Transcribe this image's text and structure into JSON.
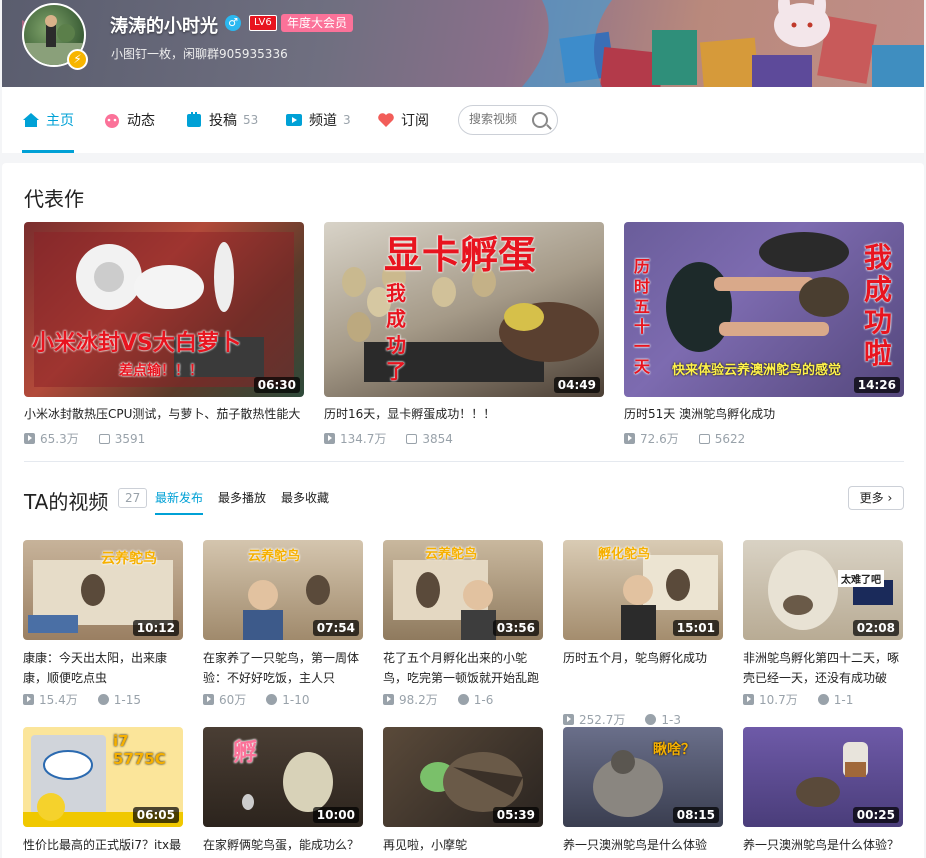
{
  "header": {
    "username": "涛涛的小时光",
    "gender_icon": "♂",
    "level": "LV6",
    "vip": "年度大会员",
    "sign": "小图钉一枚，闲聊群905935336",
    "avatar_badge": "⚡"
  },
  "nav": {
    "tabs": [
      {
        "label": "主页",
        "count": "",
        "icon": "home-icon"
      },
      {
        "label": "动态",
        "count": "",
        "icon": "dynamic-icon"
      },
      {
        "label": "投稿",
        "count": "53",
        "icon": "upload-icon"
      },
      {
        "label": "频道",
        "count": "3",
        "icon": "channel-icon"
      },
      {
        "label": "订阅",
        "count": "",
        "icon": "heart-icon"
      }
    ],
    "search_placeholder": "搜索视频"
  },
  "masterpiece": {
    "title": "代表作",
    "videos": [
      {
        "title": "小米冰封散热压CPU测试，与萝卜、茄子散热性能大",
        "duration": "06:30",
        "views": "65.3万",
        "danmaku": "3591",
        "overlay": "小米冰封VS大白萝卜",
        "overlay2": "差点输！！！"
      },
      {
        "title": "历时16天，显卡孵蛋成功！！！",
        "duration": "04:49",
        "views": "134.7万",
        "danmaku": "3854",
        "overlay": "显卡孵蛋",
        "overlay2": "我成功了"
      },
      {
        "title": "历时51天 澳洲鸵鸟孵化成功",
        "duration": "14:26",
        "views": "72.6万",
        "danmaku": "5622",
        "overlay": "我成功啦",
        "overlay2": "快来体验云养澳洲鸵鸟的感觉",
        "overlay3": "历时五十一天"
      }
    ]
  },
  "videos_section": {
    "title": "TA的视频",
    "count": "27",
    "sort_tabs": [
      "最新发布",
      "最多播放",
      "最多收藏"
    ],
    "more": "更多"
  },
  "videos": [
    {
      "title": "康康：今天出太阳，出来康康，顺便吃点虫",
      "duration": "10:12",
      "views": "15.4万",
      "comments": "1-15",
      "overlay": "云养鸵鸟"
    },
    {
      "title": "在家养了一只鸵鸟，第一周体验：不好好吃饭，主人只",
      "duration": "07:54",
      "views": "60万",
      "comments": "1-10",
      "overlay": "云养鸵鸟"
    },
    {
      "title": "花了五个月孵化出来的小鸵鸟，吃完第一顿饭就开始乱跑",
      "duration": "03:56",
      "views": "98.2万",
      "comments": "1-6",
      "overlay": "云养鸵鸟"
    },
    {
      "title": "历时五个月，鸵鸟孵化成功",
      "duration": "15:01",
      "views": "252.7万",
      "comments": "1-3",
      "overlay": "孵化鸵鸟"
    },
    {
      "title": "非洲鸵鸟孵化第四十二天，啄壳已经一天，还没有成功破",
      "duration": "02:08",
      "views": "10.7万",
      "comments": "1-1",
      "overlay": "太难了吧"
    },
    {
      "title": "性价比最高的正式版i7？itx最",
      "duration": "06:05",
      "views": "",
      "comments": "",
      "overlay": "i7 5775C"
    },
    {
      "title": "在家孵俩鸵鸟蛋，能成功么？",
      "duration": "10:00",
      "views": "",
      "comments": "",
      "overlay": "孵"
    },
    {
      "title": "再见啦，小摩鸵",
      "duration": "05:39",
      "views": "",
      "comments": "",
      "overlay": ""
    },
    {
      "title": "养一只澳洲鸵鸟是什么体验",
      "duration": "08:15",
      "views": "",
      "comments": "",
      "overlay": "瞅啥？"
    },
    {
      "title": "养一只澳洲鸵鸟是什么体验？",
      "duration": "00:25",
      "views": "",
      "comments": "",
      "overlay": ""
    }
  ]
}
